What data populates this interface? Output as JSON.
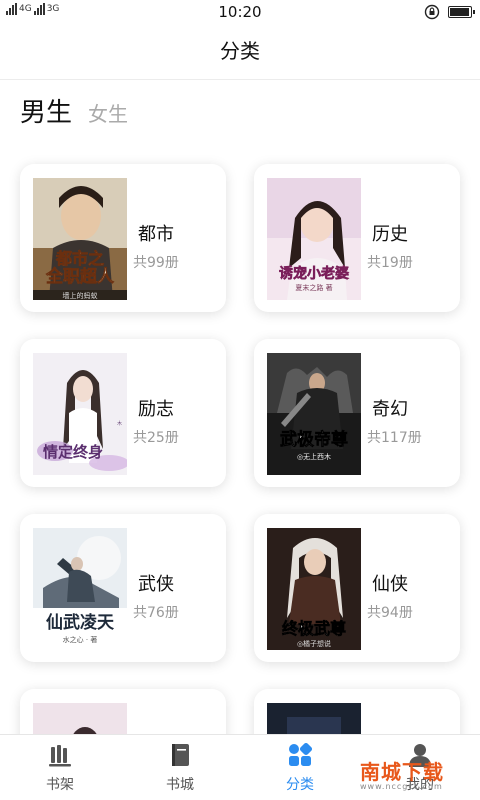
{
  "status": {
    "network_left": "4G",
    "network_right": "3G",
    "time": "10:20"
  },
  "header": {
    "title": "分类"
  },
  "gender_tabs": {
    "male": "男生",
    "female": "女生"
  },
  "categories": [
    {
      "name": "都市",
      "count": "共99册",
      "cover_title": "都市之全职超人",
      "cover_author": "墙上的蚂蚁"
    },
    {
      "name": "历史",
      "count": "共19册",
      "cover_title": "诱宠小老婆",
      "cover_author": "夏末之路 著"
    },
    {
      "name": "励志",
      "count": "共25册",
      "cover_title": "情定终身",
      "cover_author": ""
    },
    {
      "name": "奇幻",
      "count": "共117册",
      "cover_title": "武极帝尊",
      "cover_author": "◎无上西木"
    },
    {
      "name": "武侠",
      "count": "共76册",
      "cover_title": "仙武凌天",
      "cover_author": "水之心 · 著"
    },
    {
      "name": "仙侠",
      "count": "共94册",
      "cover_title": "终极武尊",
      "cover_author": "◎橘子想说"
    }
  ],
  "bottom_nav": [
    {
      "label": "书架",
      "icon": "bookshelf-icon",
      "active": false
    },
    {
      "label": "书城",
      "icon": "book-icon",
      "active": false
    },
    {
      "label": "分类",
      "icon": "category-icon",
      "active": true
    },
    {
      "label": "我的",
      "icon": "user-icon",
      "active": false
    }
  ],
  "watermark": {
    "text": "南城下载",
    "url": "www.nccgcc.com"
  },
  "colors": {
    "accent": "#2b8cf0",
    "watermark": "#e8581b"
  }
}
